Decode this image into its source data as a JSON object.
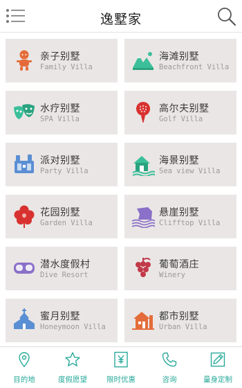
{
  "header": {
    "title": "逸墅家"
  },
  "villas": [
    {
      "cn": "亲子别墅",
      "en": "Family Villa",
      "icon": "family-baby-icon"
    },
    {
      "cn": "海滩别墅",
      "en": "Beachfront Villa",
      "icon": "beach-mountain-icon"
    },
    {
      "cn": "水疗别墅",
      "en": "SPA Villa",
      "icon": "spa-masks-icon"
    },
    {
      "cn": "高尔夫别墅",
      "en": "Golf Villa",
      "icon": "golf-ball-icon"
    },
    {
      "cn": "派对别墅",
      "en": "Party Villa",
      "icon": "party-drinks-icon"
    },
    {
      "cn": "海景别墅",
      "en": "Sea view Villa",
      "icon": "sea-view-house-icon"
    },
    {
      "cn": "花园别墅",
      "en": "Garden Villa",
      "icon": "flower-icon"
    },
    {
      "cn": "悬崖别墅",
      "en": "Clifftop Villa",
      "icon": "cliff-icon"
    },
    {
      "cn": "潜水度假村",
      "en": "Dive Resort",
      "icon": "dive-mask-icon"
    },
    {
      "cn": "葡萄酒庄",
      "en": "Winery",
      "icon": "grapes-icon"
    },
    {
      "cn": "蜜月别墅",
      "en": "Honeymoon Villa",
      "icon": "chapel-icon"
    },
    {
      "cn": "都市别墅",
      "en": "Urban Villa",
      "icon": "city-house-icon"
    }
  ],
  "tabs": [
    {
      "label": "目的地",
      "icon": "location-pin-icon"
    },
    {
      "label": "度假愿望",
      "icon": "star-icon"
    },
    {
      "label": "限时优惠",
      "icon": "yuan-coupon-icon"
    },
    {
      "label": "咨询",
      "icon": "phone-icon"
    },
    {
      "label": "量身定制",
      "icon": "tailor-pen-icon"
    }
  ],
  "colors": {
    "accent": "#28a99a",
    "card_bg": "#eae6e5",
    "orange": "#e46c3a",
    "teal": "#3bbf9a",
    "red": "#d7322f",
    "blue": "#5b8fd3",
    "purple": "#8a70c8",
    "berry": "#c23a4a"
  }
}
